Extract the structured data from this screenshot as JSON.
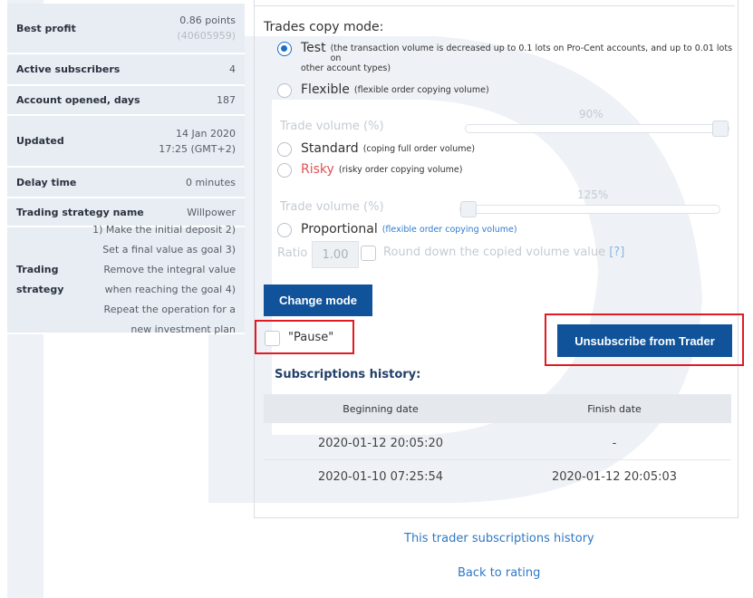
{
  "stats": {
    "best_profit_label": "Best profit",
    "best_profit_value": "0.86 points",
    "best_profit_sub": "(40605959)",
    "active_subscribers_label": "Active subscribers",
    "active_subscribers_value": "4",
    "account_opened_label": "Account opened, days",
    "account_opened_value": "187",
    "updated_label": "Updated",
    "updated_date": "14 Jan 2020",
    "updated_time": "17:25 (GMT+2)",
    "delay_label": "Delay time",
    "delay_value": "0 minutes",
    "strategy_name_label": "Trading strategy name",
    "strategy_name_value": "Willpower",
    "strategy_label": "Trading strategy",
    "strategy_value": "1) Make the initial deposit 2) Set a final value as goal 3) Remove the integral value when reaching the goal 4) Repeat the operation for a new investment plan"
  },
  "copy_mode": {
    "title": "Trades copy mode:",
    "test_label": "Test",
    "test_note": "(the transaction volume is decreased up to 0.1 lots on Pro-Cent accounts, and up to 0.01 lots on",
    "test_note_cont": "other account types)",
    "flexible_label": "Flexible",
    "flexible_note": "(flexible order copying volume)",
    "trade_volume_label_1": "Trade volume (%)",
    "trade_volume_pct_1": "90%",
    "trade_volume_level_1": 1.0,
    "standard_label": "Standard",
    "standard_note": "(coping full order volume)",
    "risky_label": "Risky",
    "risky_note": "(risky order copying volume)",
    "trade_volume_label_2": "Trade volume (%)",
    "trade_volume_pct_2": "125%",
    "trade_volume_level_2": 0.0,
    "proportional_label": "Proportional",
    "proportional_note": "(flexible order copying volume)",
    "ratio_label": "Ratio",
    "ratio_value": "1.00",
    "round_label": "Round down the copied volume value",
    "round_help": "[?]",
    "selected": "Test"
  },
  "actions": {
    "change_mode": "Change mode",
    "pause_label": "\"Pause\"",
    "unsubscribe": "Unsubscribe from Trader"
  },
  "history": {
    "title": "Subscriptions history:",
    "columns": [
      "Beginning date",
      "Finish date"
    ],
    "rows": [
      [
        "2020-01-12 20:05:20",
        "-"
      ],
      [
        "2020-01-10 07:25:54",
        "2020-01-12 20:05:03"
      ]
    ]
  },
  "links": {
    "trader_history": "This trader subscriptions history",
    "back": "Back to rating"
  },
  "colors": {
    "primary_button": "#10539a",
    "highlight_box": "#e01b24",
    "link": "#2f78c4",
    "risky": "#e05252"
  }
}
